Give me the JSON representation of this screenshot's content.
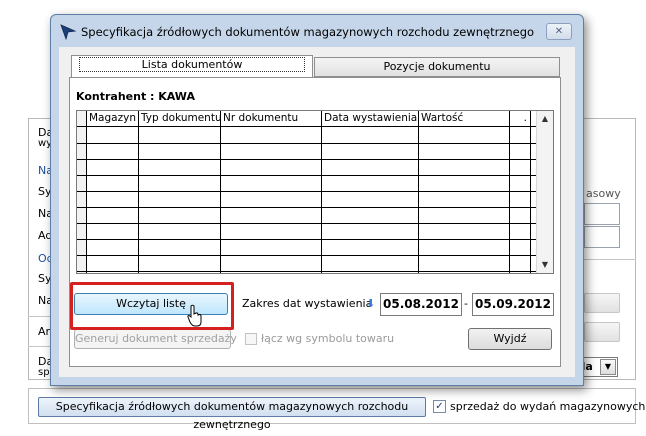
{
  "background": {
    "labels": [
      "Da",
      "wy",
      "Na",
      "Sy",
      "Na",
      "Ad",
      "Od",
      "Sy",
      "Na",
      "An",
      "Da",
      "spr"
    ],
    "right_fragment": "asowy",
    "select_value": "eda",
    "select_arrow": "▼"
  },
  "bottom": {
    "spec_button": "Specyfikacja źródłowych dokumentów magazynowych rozchodu zewnętrznego",
    "sales_checkbox_checked": true,
    "sales_checkbox_mark": "✓",
    "sales_label": "sprzedaż do wydań magazynowych"
  },
  "dialog": {
    "title": "Specyfikacja źródłowych dokumentów magazynowych rozchodu zewnętrznego",
    "close_label": "✕",
    "tabs": [
      {
        "label": "Lista dokumentów",
        "active": true
      },
      {
        "label": "Pozycje dokumentu",
        "active": false
      }
    ],
    "contractor": "Kontrahent : KAWA",
    "grid": {
      "columns": [
        "Magazyn",
        "Typ dokumentu",
        "Nr dokumentu",
        "Data wystawienia",
        "Wartość",
        "."
      ],
      "rows": []
    },
    "load_button": "Wczytaj listę",
    "generate_button": "Generuj dokument sprzedaży",
    "date_range_label": "Zakres dat wystawienia",
    "date_icon": "⬇",
    "date_from": "05.08.2012",
    "date_sep": "-",
    "date_to": "05.09.2012",
    "merge_label": "łącz wg symbolu towaru",
    "merge_checked": false,
    "exit_button": "Wyjdź",
    "scroll_up": "▲",
    "scroll_down": "▼"
  }
}
